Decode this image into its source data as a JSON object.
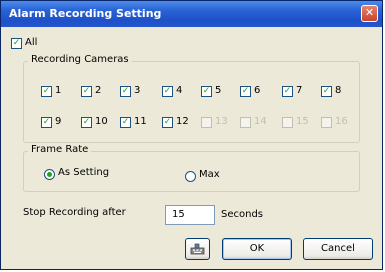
{
  "window": {
    "title": "Alarm Recording Setting",
    "close_glyph": "✕"
  },
  "all_checkbox": {
    "label": "All",
    "checked": true
  },
  "recording_cameras": {
    "group_title": "Recording Cameras",
    "cameras": [
      {
        "label": "1",
        "checked": true,
        "enabled": true
      },
      {
        "label": "2",
        "checked": true,
        "enabled": true
      },
      {
        "label": "3",
        "checked": true,
        "enabled": true
      },
      {
        "label": "4",
        "checked": true,
        "enabled": true
      },
      {
        "label": "5",
        "checked": true,
        "enabled": true
      },
      {
        "label": "6",
        "checked": true,
        "enabled": true
      },
      {
        "label": "7",
        "checked": true,
        "enabled": true
      },
      {
        "label": "8",
        "checked": true,
        "enabled": true
      },
      {
        "label": "9",
        "checked": true,
        "enabled": true
      },
      {
        "label": "10",
        "checked": true,
        "enabled": true
      },
      {
        "label": "11",
        "checked": true,
        "enabled": true
      },
      {
        "label": "12",
        "checked": true,
        "enabled": true
      },
      {
        "label": "13",
        "checked": false,
        "enabled": false
      },
      {
        "label": "14",
        "checked": false,
        "enabled": false
      },
      {
        "label": "15",
        "checked": false,
        "enabled": false
      },
      {
        "label": "16",
        "checked": false,
        "enabled": false
      }
    ]
  },
  "frame_rate": {
    "group_title": "Frame Rate",
    "option_as_setting": "As Setting",
    "option_max": "Max",
    "selected": "As Setting"
  },
  "stop_recording": {
    "label": "Stop Recording after",
    "value": "15",
    "unit": "Seconds"
  },
  "buttons": {
    "ok_label": "OK",
    "cancel_label": "Cancel",
    "keyboard_icon": "keyboard-icon"
  },
  "colors": {
    "title_bar": "#2a63d6",
    "check_mark": "#21a121"
  }
}
